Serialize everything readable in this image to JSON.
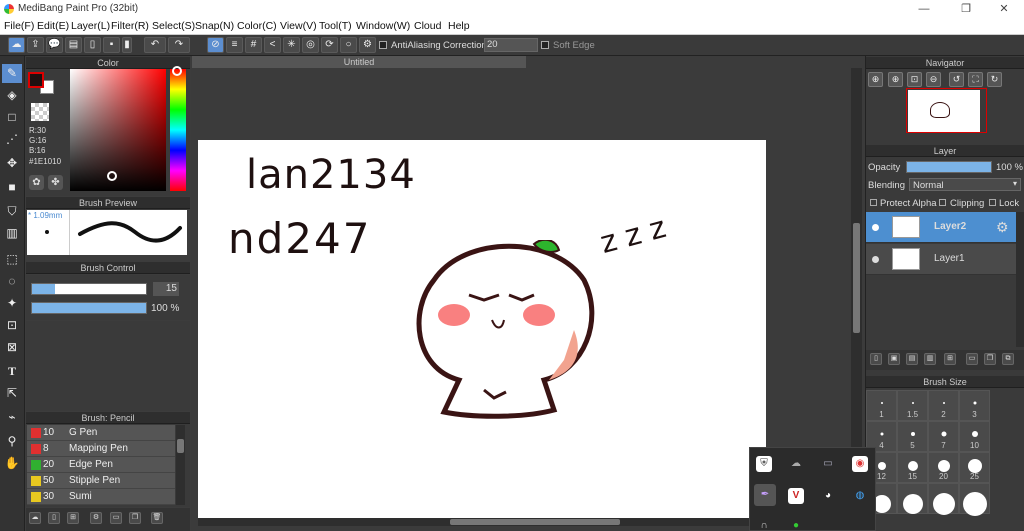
{
  "window": {
    "title": "MediBang Paint Pro (32bit)",
    "min": "—",
    "restore": "❐",
    "close": "✕"
  },
  "menu": [
    "File(F)",
    "Edit(E)",
    "Layer(L)",
    "Filter(R)",
    "Select(S)",
    "Snap(N)",
    "Color(C)",
    "View(V)",
    "Tool(T)",
    "Window(W)",
    "Cloud",
    "Help"
  ],
  "toolbar": {
    "antialiasing": "AntiAliasing",
    "correction_label": "Correction",
    "correction_value": "20",
    "soft_edge": "Soft Edge"
  },
  "color_panel": {
    "title": "Color",
    "r": "R:30",
    "g": "G:16",
    "b": "B:16",
    "hex": "#1E1010",
    "foreground": "#1e1010"
  },
  "brush_preview": {
    "title": "Brush Preview",
    "size": "* 1.09mm"
  },
  "brush_control": {
    "title": "Brush Control",
    "size_value": "15",
    "size_fraction": 0.2,
    "opacity_value": "100 %",
    "opacity_fraction": 1.0
  },
  "brush_list": {
    "title": "Brush: Pencil",
    "items": [
      {
        "size": "10",
        "name": "G Pen",
        "color": "#e03030"
      },
      {
        "size": "8",
        "name": "Mapping Pen",
        "color": "#e03030"
      },
      {
        "size": "20",
        "name": "Edge Pen",
        "color": "#30b030"
      },
      {
        "size": "50",
        "name": "Stipple Pen",
        "color": "#e8c820"
      },
      {
        "size": "30",
        "name": "Sumi",
        "color": "#e8c820"
      }
    ]
  },
  "document": {
    "tab": "Untitled",
    "text_line1": "lan2134",
    "text_line2": "nd247",
    "zzz": "z z z"
  },
  "navigator": {
    "title": "Navigator"
  },
  "layer_panel": {
    "title": "Layer",
    "opacity_label": "Opacity",
    "opacity_value": "100 %",
    "opacity_fraction": 1.0,
    "blending_label": "Blending",
    "blending_value": "Normal",
    "protect_alpha": "Protect Alpha",
    "clipping": "Clipping",
    "lock": "Lock",
    "layers": [
      {
        "name": "Layer2",
        "selected": true
      },
      {
        "name": "Layer1",
        "selected": false
      }
    ]
  },
  "brush_size": {
    "title": "Brush Size",
    "sizes": [
      "1",
      "1.5",
      "2",
      "3",
      "4",
      "5",
      "7",
      "10",
      "12",
      "15",
      "20",
      "25"
    ]
  }
}
